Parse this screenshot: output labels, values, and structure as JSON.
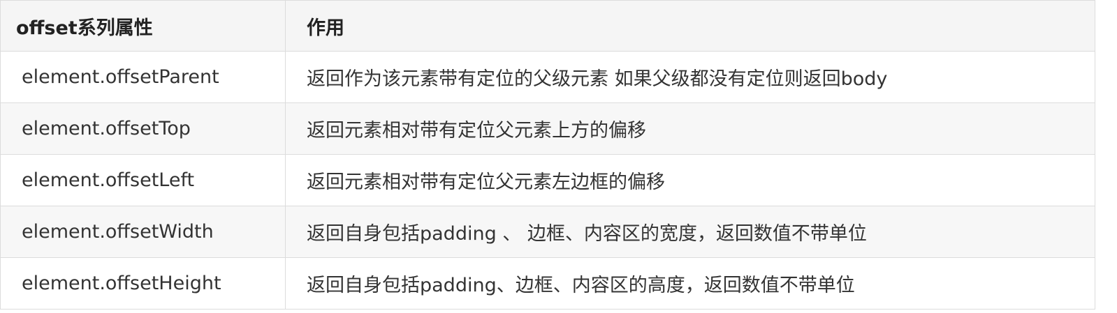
{
  "table": {
    "headers": {
      "attribute": "offset系列属性",
      "purpose": "作用"
    },
    "rows": [
      {
        "attribute": "element.offsetParent",
        "purpose": "返回作为该元素带有定位的父级元素 如果父级都没有定位则返回body"
      },
      {
        "attribute": "element.offsetTop",
        "purpose": "返回元素相对带有定位父元素上方的偏移"
      },
      {
        "attribute": "element.offsetLeft",
        "purpose": "返回元素相对带有定位父元素左边框的偏移"
      },
      {
        "attribute": "element.offsetWidth",
        "purpose": "返回自身包括padding 、 边框、内容区的宽度，返回数值不带单位"
      },
      {
        "attribute": "element.offsetHeight",
        "purpose": "返回自身包括padding、边框、内容区的高度，返回数值不带单位"
      }
    ]
  }
}
